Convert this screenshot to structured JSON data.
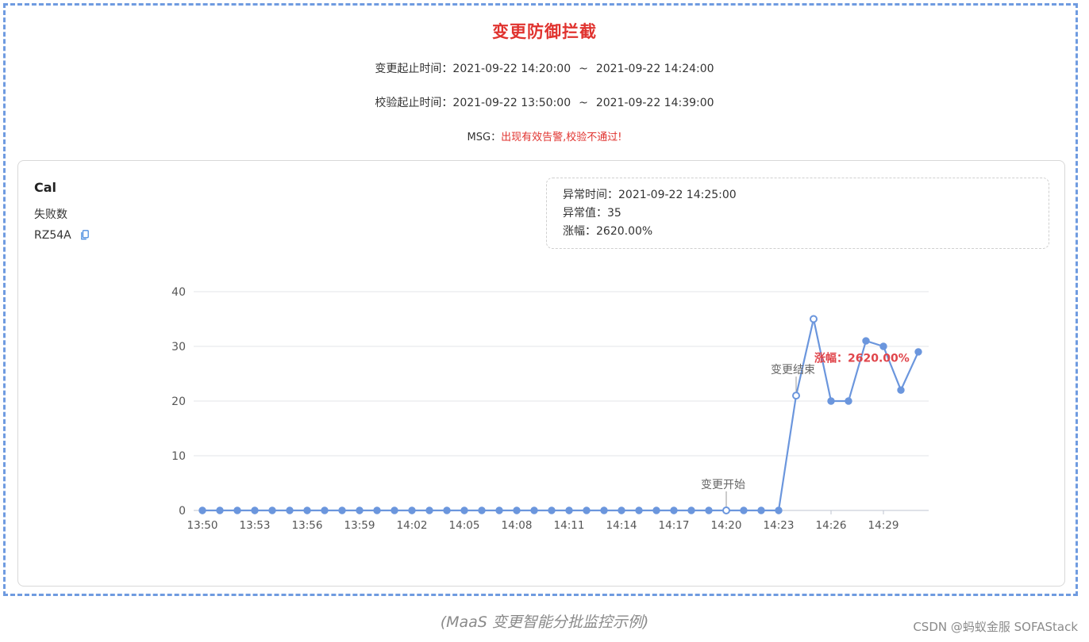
{
  "header": {
    "title": "变更防御拦截",
    "change_label": "变更起止时间：",
    "change_start": "2021-09-22 14:20:00",
    "change_end": "2021-09-22 14:24:00",
    "verify_label": "校验起止时间：",
    "verify_start": "2021-09-22 13:50:00",
    "verify_end": "2021-09-22 14:39:00",
    "range_sep": "~",
    "msg_label": "MSG：",
    "msg_text": "出现有效告警,校验不通过!"
  },
  "card": {
    "title": "Cal",
    "metric": "失败数",
    "id": "RZ54A"
  },
  "anomaly": {
    "time_label": "异常时间：",
    "time_value": "2021-09-22 14:25:00",
    "value_label": "异常值：",
    "value": "35",
    "change_label": "涨幅：",
    "change_value": "2620.00%"
  },
  "chart_data": {
    "type": "line",
    "x": [
      "13:50",
      "13:51",
      "13:52",
      "13:53",
      "13:54",
      "13:55",
      "13:56",
      "13:57",
      "13:58",
      "13:59",
      "14:00",
      "14:01",
      "14:02",
      "14:03",
      "14:04",
      "14:05",
      "14:06",
      "14:07",
      "14:08",
      "14:09",
      "14:10",
      "14:11",
      "14:12",
      "14:13",
      "14:14",
      "14:15",
      "14:16",
      "14:17",
      "14:18",
      "14:19",
      "14:20",
      "14:21",
      "14:22",
      "14:23",
      "14:24",
      "14:25",
      "14:26",
      "14:27",
      "14:28",
      "14:29",
      "14:30",
      "14:31"
    ],
    "x_tick_labels": [
      "13:50",
      "13:53",
      "13:56",
      "13:59",
      "14:02",
      "14:05",
      "14:08",
      "14:11",
      "14:14",
      "14:17",
      "14:20",
      "14:23",
      "14:26",
      "14:29"
    ],
    "values": [
      0,
      0,
      0,
      0,
      0,
      0,
      0,
      0,
      0,
      0,
      0,
      0,
      0,
      0,
      0,
      0,
      0,
      0,
      0,
      0,
      0,
      0,
      0,
      0,
      0,
      0,
      0,
      0,
      0,
      0,
      0,
      0,
      0,
      0,
      21,
      35,
      20,
      20,
      31,
      30,
      22,
      29
    ],
    "ylim": [
      0,
      40
    ],
    "y_ticks": [
      0,
      10,
      20,
      30,
      40
    ],
    "grid": true,
    "color": "#6b96dd",
    "hollow_points": [
      "14:20",
      "14:24",
      "14:25"
    ],
    "annotations": [
      {
        "x": "14:20",
        "text": "变更开始"
      },
      {
        "x": "14:24",
        "text": "变更结束"
      },
      {
        "x": "14:25",
        "text": "涨幅：2620.00%",
        "color": "#e0454b"
      }
    ]
  },
  "footer": {
    "caption": "(MaaS 变更智能分批监控示例)",
    "watermark": "CSDN @蚂蚁金服 SOFAStack"
  }
}
